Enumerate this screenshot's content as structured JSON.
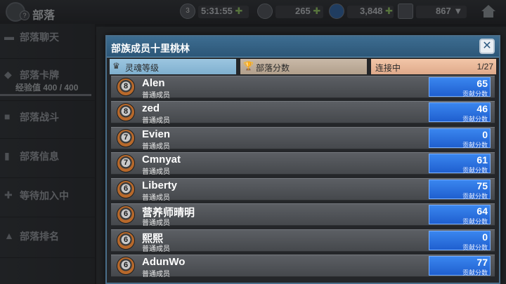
{
  "topbar": {
    "title": "部落",
    "avatar_badge": "?",
    "stat_energy_badge": "3",
    "stat_time": "5:31:55",
    "stat_gold": "265",
    "stat_gems": "3,848",
    "stat_trophies": "867",
    "plus": "✚",
    "dropdown": "▼"
  },
  "sidebar": {
    "items": [
      {
        "label": "部落聊天",
        "icon": "chat-icon"
      },
      {
        "label": "部落卡牌",
        "sub": "经验值 400 / 400",
        "icon": "card-icon"
      },
      {
        "label": "部落战斗",
        "icon": "battle-icon"
      },
      {
        "label": "部落信息",
        "icon": "info-icon"
      },
      {
        "label": "等待加入中",
        "icon": "plus-icon"
      },
      {
        "label": "部落排名",
        "icon": "ranking-icon"
      }
    ]
  },
  "dialog": {
    "title": "部族成员十里桃林",
    "close": "✕",
    "tabs": {
      "level": "灵魂等级",
      "points": "部落分数",
      "connecting": "连接中",
      "count": "1/27"
    },
    "members": [
      {
        "rank": "8",
        "name": "Alen",
        "role": "普通成员",
        "score": "65",
        "score_label": "贡献分数"
      },
      {
        "rank": "8",
        "name": "zed",
        "role": "普通成员",
        "score": "46",
        "score_label": "贡献分数"
      },
      {
        "rank": "7",
        "name": "Evien",
        "role": "普通成员",
        "score": "0",
        "score_label": "贡献分数"
      },
      {
        "rank": "7",
        "name": "Cmnyat",
        "role": "普通成员",
        "score": "61",
        "score_label": "贡献分数"
      },
      {
        "rank": "6",
        "name": "Liberty",
        "role": "普通成员",
        "score": "75",
        "score_label": "贡献分数"
      },
      {
        "rank": "6",
        "name": "营养师晴明",
        "role": "普通成员",
        "score": "64",
        "score_label": "贡献分数"
      },
      {
        "rank": "6",
        "name": "熙熙",
        "role": "普通成员",
        "score": "0",
        "score_label": "贡献分数"
      },
      {
        "rank": "6",
        "name": "AdunWo",
        "role": "普通成员",
        "score": "77",
        "score_label": "贡献分数"
      }
    ]
  },
  "colors": {
    "header_blue": "#2c5677",
    "score_blue": "#1f5fcf",
    "rank_bronze": "#b8692b"
  }
}
